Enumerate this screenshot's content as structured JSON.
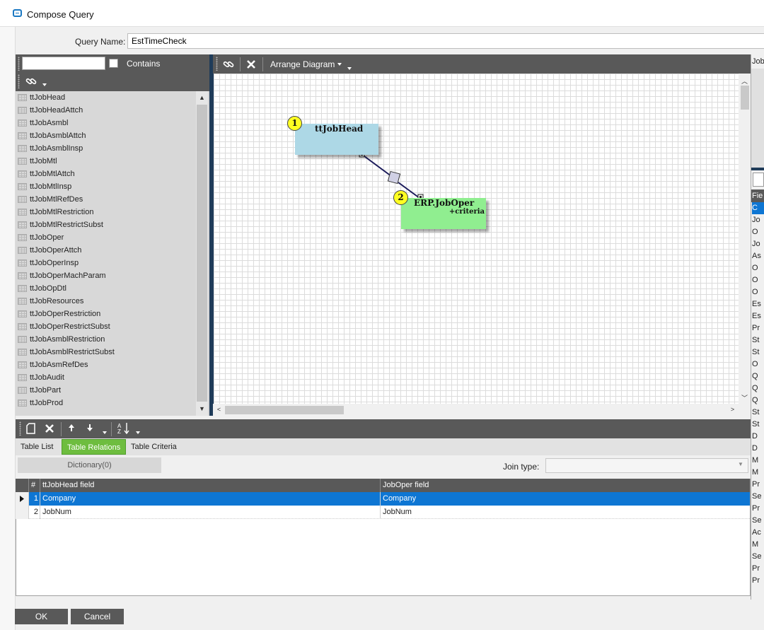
{
  "window": {
    "title": "Compose Query"
  },
  "query": {
    "name_label": "Query Name:",
    "name_value": "EstTimeCheck"
  },
  "left_panel": {
    "contains_label": "Contains",
    "tables": [
      "ttJobHead",
      "ttJobHeadAttch",
      "ttJobAsmbl",
      "ttJobAsmblAttch",
      "ttJobAsmblInsp",
      "ttJobMtl",
      "ttJobMtlAttch",
      "ttJobMtlInsp",
      "ttJobMtlRefDes",
      "ttJobMtlRestriction",
      "ttJobMtlRestrictSubst",
      "ttJobOper",
      "ttJobOperAttch",
      "ttJobOperInsp",
      "ttJobOperMachParam",
      "ttJobOpDtl",
      "ttJobResources",
      "ttJobOperRestriction",
      "ttJobOperRestrictSubst",
      "ttJobAsmblRestriction",
      "ttJobAsmblRestrictSubst",
      "ttJobAsmRefDes",
      "ttJobAudit",
      "ttJobPart",
      "ttJobProd"
    ]
  },
  "diagram": {
    "toolbar": {
      "arrange_label": "Arrange Diagram"
    },
    "nodes": [
      {
        "badge": "1",
        "title": "ttJobHead",
        "subtitle": "",
        "color": "#add8e6"
      },
      {
        "badge": "2",
        "title": "ERP.JobOper",
        "subtitle": "+criteria",
        "color": "#90ee90"
      }
    ]
  },
  "right_strip": {
    "header": "Job",
    "column_header": "Fie",
    "cells": [
      "C",
      "Jo",
      "O",
      "Jo",
      "As",
      "O",
      "O",
      "O",
      "Es",
      "Es",
      "Pr",
      "St",
      "St",
      "O",
      "Q",
      "Q",
      "Q",
      "St",
      "St",
      "D",
      "D",
      "M",
      "M",
      "Pr",
      "Se",
      "Pr",
      "Se",
      "Ac",
      "M",
      "Se",
      "Pr",
      "Pr"
    ]
  },
  "bottom": {
    "tabs": [
      "Table List",
      "Table Relations",
      "Table Criteria"
    ],
    "active_tab": "Table Relations",
    "dictionary_label": "Dictionary(0)",
    "join_type_label": "Join type:",
    "join_type_value": "",
    "grid": {
      "columns": [
        "#",
        "ttJobHead field",
        "JobOper field"
      ],
      "rows": [
        {
          "num": "1",
          "left": "Company",
          "right": "Company",
          "selected": true
        },
        {
          "num": "2",
          "left": "JobNum",
          "right": "JobNum",
          "selected": false
        }
      ]
    }
  },
  "footer": {
    "ok_label": "OK",
    "cancel_label": "Cancel"
  },
  "colors": {
    "toolbar": "#595959",
    "selection": "#0e76d3",
    "active_tab": "#6ebd3f"
  }
}
